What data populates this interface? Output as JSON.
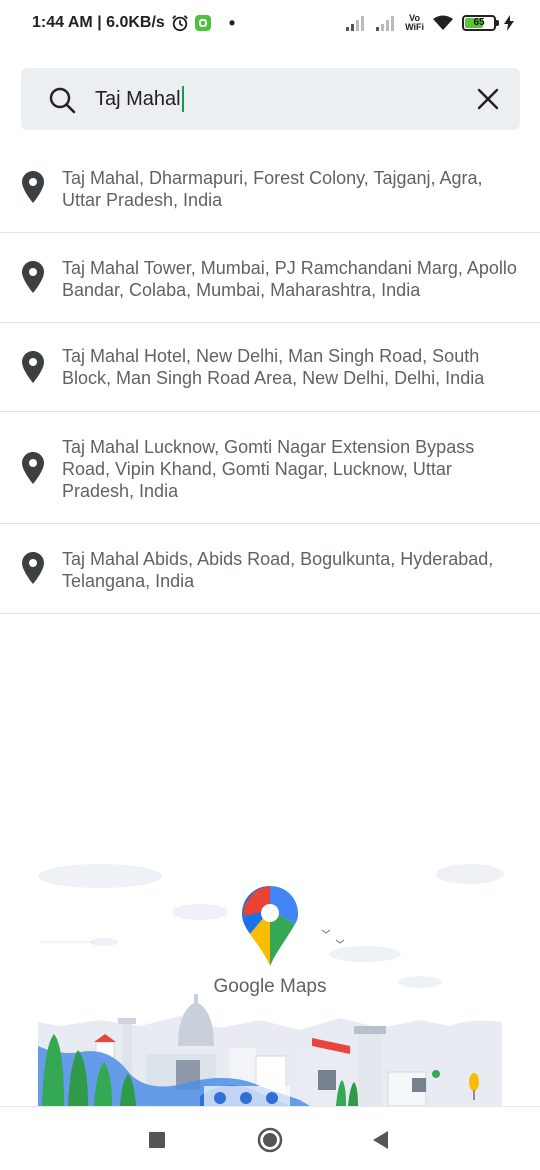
{
  "status_bar": {
    "time_speed": "1:44 AM | 6.0KB/s",
    "vowifi": "Vo\nWiFi",
    "battery_level": "65",
    "battery_fraction": 0.65,
    "icons": [
      "alarm-icon",
      "app-notification-icon",
      "signal-icon",
      "wifi-icon",
      "battery-icon",
      "charging-icon"
    ]
  },
  "search": {
    "value": "Taj Mahal",
    "icons": [
      "search-icon",
      "clear-icon"
    ]
  },
  "results": [
    "Taj Mahal, Dharmapuri, Forest Colony, Tajganj, Agra, Uttar Pradesh, India",
    "Taj Mahal Tower, Mumbai, PJ Ramchandani Marg, Apollo Bandar, Colaba, Mumbai, Maharashtra, India",
    "Taj Mahal Hotel, New Delhi, Man Singh Road, South Block, Man Singh Road Area, New Delhi, Delhi, India",
    "Taj Mahal Lucknow, Gomti Nagar Extension Bypass Road, Vipin Khand, Gomti Nagar, Lucknow, Uttar Pradesh, India",
    "Taj Mahal Abids, Abids Road, Bogulkunta, Hyderabad, Telangana, India"
  ],
  "branding": {
    "name": "Google Maps"
  },
  "nav": {
    "icons": [
      "recents-square-icon",
      "home-circle-icon",
      "back-triangle-icon"
    ]
  },
  "colors": {
    "search_bg": "#eceff1",
    "caret": "#0f9d58",
    "text": "#5f6368"
  }
}
